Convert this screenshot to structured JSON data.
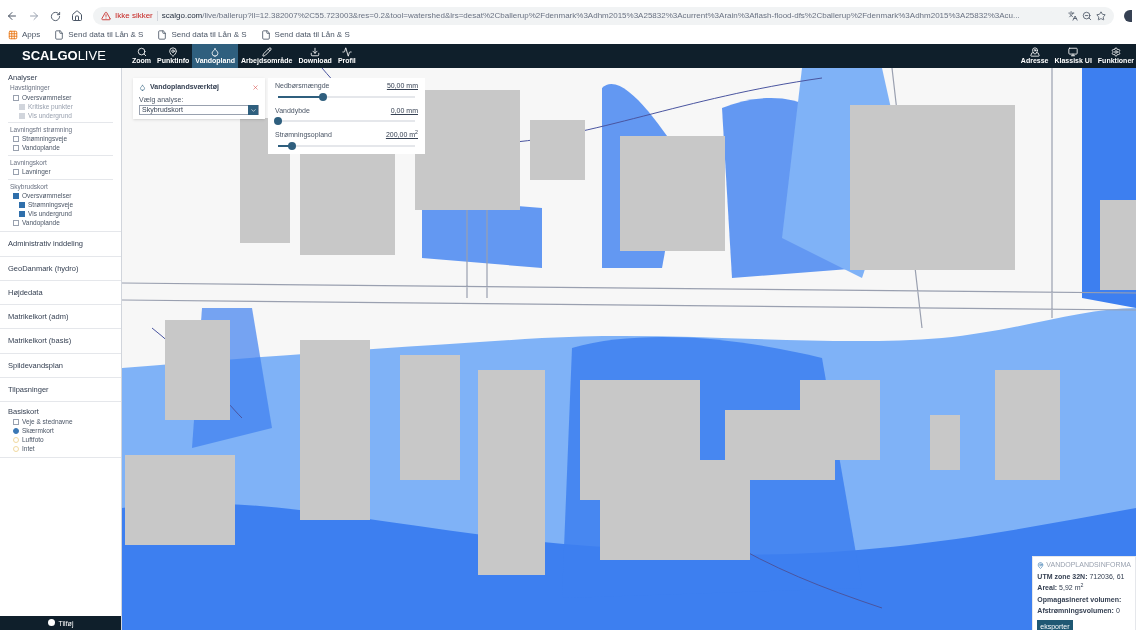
{
  "browser": {
    "warning": "Ikke sikker",
    "url_host": "scalgo.com",
    "url_path": "/live/ballerup?ll=12.382007%2C55.723003&res=0.2&tool=watershed&lrs=desat%2Cballerup%2Fdenmark%3Adhm2015%3A25832%3Acurrent%3Arain%3Aflash-flood-dfs%2Cballerup%2Fdenmark%3Adhm2015%3A25832%3Acu...",
    "bookmarks": [
      {
        "label": "Apps",
        "kind": "apps"
      },
      {
        "label": "Send data til Lån & S",
        "kind": "page"
      },
      {
        "label": "Send data til Lån & S",
        "kind": "page"
      },
      {
        "label": "Send data til Lån & S",
        "kind": "page"
      }
    ]
  },
  "header": {
    "logo": {
      "main": "SCALGO",
      "suffix": "LIVE"
    },
    "nav": [
      {
        "label": "Zoom",
        "selected": false
      },
      {
        "label": "Punktinfo",
        "selected": false
      },
      {
        "label": "Vandopland",
        "selected": true
      },
      {
        "label": "Arbejdsområde",
        "selected": false
      },
      {
        "label": "Download",
        "selected": false
      },
      {
        "label": "Profil",
        "selected": false
      }
    ],
    "right_nav": [
      {
        "label": "Adresse"
      },
      {
        "label": "Klassisk UI"
      },
      {
        "label": "Funktioner"
      }
    ]
  },
  "sidebar": {
    "sections": [
      {
        "title": "Analyser",
        "groups": [
          {
            "title": "Havstigninger",
            "items": [
              {
                "label": "Oversvømmelser",
                "kind": "checkbox",
                "checked": false,
                "disabled": false,
                "children": [
                  {
                    "label": "Kritiske punkter",
                    "kind": "checkbox",
                    "checked": false,
                    "disabled": true
                  },
                  {
                    "label": "Vis undergrund",
                    "kind": "checkbox",
                    "checked": false,
                    "disabled": true
                  }
                ]
              }
            ]
          },
          {
            "title": "Lavningsfri strømning",
            "items": [
              {
                "label": "Strømningsveje",
                "kind": "checkbox",
                "checked": false,
                "disabled": false
              },
              {
                "label": "Vandoplande",
                "kind": "checkbox",
                "checked": false,
                "disabled": false
              }
            ]
          },
          {
            "title": "Lavningskort",
            "items": [
              {
                "label": "Lavninger",
                "kind": "checkbox",
                "checked": false,
                "disabled": false
              }
            ]
          },
          {
            "title": "Skybrudskort",
            "items": [
              {
                "label": "Oversvømmelser",
                "kind": "checkbox",
                "checked": true,
                "disabled": false,
                "children": [
                  {
                    "label": "Strømningsveje",
                    "kind": "checkbox",
                    "checked": true,
                    "disabled": false
                  },
                  {
                    "label": "Vis undergrund",
                    "kind": "checkbox",
                    "checked": true,
                    "disabled": false
                  }
                ]
              },
              {
                "label": "Vandoplande",
                "kind": "checkbox",
                "checked": false,
                "disabled": false
              }
            ]
          }
        ]
      },
      {
        "title": "Administrativ inddeling"
      },
      {
        "title": "GeoDanmark (hydro)"
      },
      {
        "title": "Højdedata"
      },
      {
        "title": "Matrikelkort (adm)"
      },
      {
        "title": "Matrikelkort (basis)"
      },
      {
        "title": "Spildevandsplan"
      },
      {
        "title": "Tilpasninger"
      },
      {
        "title": "Basiskort",
        "groups": [
          {
            "items": [
              {
                "label": "Veje & stednavne",
                "kind": "checkbox",
                "checked": false,
                "disabled": false
              },
              {
                "label": "Skærmkort",
                "kind": "radio",
                "selected": true
              },
              {
                "label": "Luftfoto",
                "kind": "radio",
                "selected": false
              },
              {
                "label": "Intet",
                "kind": "radio",
                "selected": false
              }
            ]
          }
        ]
      }
    ],
    "footer": "Tilføj"
  },
  "tool_panel": {
    "title": "Vandoplandsværktøj",
    "analysis_label": "Vælg analyse:",
    "analysis_value": "Skybrudskort"
  },
  "sliders": [
    {
      "label": "Nedbørsmængde",
      "reading": "50,00 mm",
      "level": 0.33
    },
    {
      "label": "Vanddybde",
      "reading": "0,00 mm",
      "level": 0
    },
    {
      "label": "Strømningsopland",
      "reading": "200,00 m$^{2}$",
      "level": 0.1
    }
  ],
  "info_panel": {
    "title": "VANDOPLANDSINFORMA",
    "lines": [
      "**UTM zone 32N:** 712036, 61",
      "**Areal:** 5,92 m$^{2}$",
      "**Opmagasineret volumen:**",
      "**Afstrømningsvolumen:** 0"
    ],
    "button": "eksporter"
  }
}
